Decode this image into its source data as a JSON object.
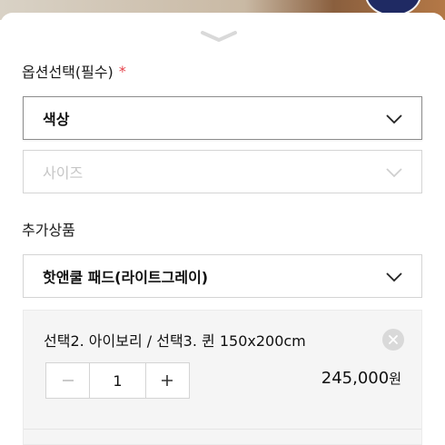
{
  "colors": {
    "required": "#e5414a",
    "border": "#d4d4d4",
    "card_bg": "#f5f5f5"
  },
  "options": {
    "title": "옵션선택(필수)",
    "required_mark": "*",
    "selects": [
      {
        "label": "색상",
        "state": "active",
        "icon": "chevron-down-icon"
      },
      {
        "label": "사이즈",
        "state": "disabled",
        "icon": "chevron-down-icon"
      }
    ]
  },
  "addons": {
    "title": "추가상품",
    "select": {
      "label": "핫앤쿨 패드(라이트그레이)",
      "icon": "chevron-down-icon"
    }
  },
  "selected_item": {
    "name": "선택2. 아이보리 / 선택3. 퀸 150x200cm",
    "quantity": "1",
    "price": "245,000",
    "price_unit": "원",
    "icons": {
      "remove": "close-icon",
      "decrease": "minus-icon",
      "increase": "plus-icon"
    }
  }
}
